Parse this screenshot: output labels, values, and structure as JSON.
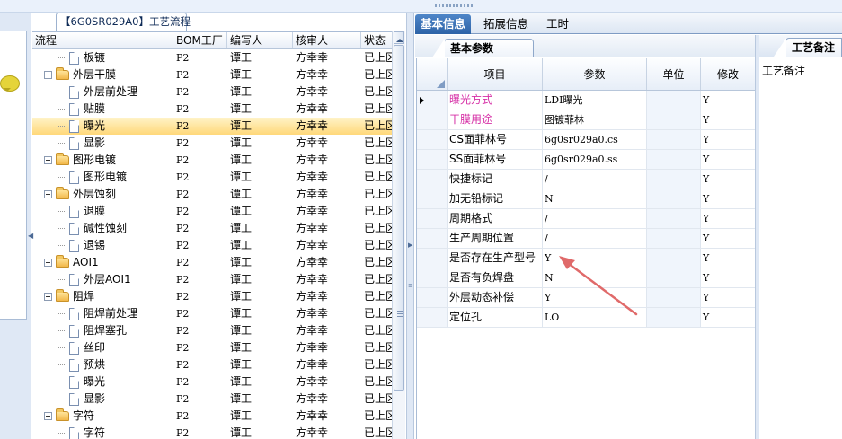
{
  "process_tab": {
    "title": "【6G0SR029A0】工艺流程"
  },
  "tree": {
    "headers": [
      "流程",
      "BOM工厂",
      "编写人",
      "核审人",
      "状态"
    ],
    "rows": [
      {
        "name": "板镀",
        "type": "doc",
        "level": 2,
        "bom": "P2",
        "writer": "谭工",
        "reviewer": "方幸幸",
        "status": "已上区"
      },
      {
        "name": "外层干膜",
        "type": "folder",
        "level": 1,
        "bom": "P2",
        "writer": "谭工",
        "reviewer": "方幸幸",
        "status": "已上区"
      },
      {
        "name": "外层前处理",
        "type": "doc",
        "level": 2,
        "bom": "P2",
        "writer": "谭工",
        "reviewer": "方幸幸",
        "status": "已上区"
      },
      {
        "name": "贴膜",
        "type": "doc",
        "level": 2,
        "bom": "P2",
        "writer": "谭工",
        "reviewer": "方幸幸",
        "status": "已上区"
      },
      {
        "name": "曝光",
        "type": "doc",
        "level": 2,
        "bom": "P2",
        "writer": "谭工",
        "reviewer": "方幸幸",
        "status": "已上区",
        "selected": true
      },
      {
        "name": "显影",
        "type": "doc",
        "level": 2,
        "bom": "P2",
        "writer": "谭工",
        "reviewer": "方幸幸",
        "status": "已上区"
      },
      {
        "name": "图形电镀",
        "type": "folder",
        "level": 1,
        "bom": "P2",
        "writer": "谭工",
        "reviewer": "方幸幸",
        "status": "已上区"
      },
      {
        "name": "图形电镀",
        "type": "doc",
        "level": 2,
        "bom": "P2",
        "writer": "谭工",
        "reviewer": "方幸幸",
        "status": "已上区"
      },
      {
        "name": "外层蚀刻",
        "type": "folder",
        "level": 1,
        "bom": "P2",
        "writer": "谭工",
        "reviewer": "方幸幸",
        "status": "已上区"
      },
      {
        "name": "退膜",
        "type": "doc",
        "level": 2,
        "bom": "P2",
        "writer": "谭工",
        "reviewer": "方幸幸",
        "status": "已上区"
      },
      {
        "name": "碱性蚀刻",
        "type": "doc",
        "level": 2,
        "bom": "P2",
        "writer": "谭工",
        "reviewer": "方幸幸",
        "status": "已上区"
      },
      {
        "name": "退锡",
        "type": "doc",
        "level": 2,
        "bom": "P2",
        "writer": "谭工",
        "reviewer": "方幸幸",
        "status": "已上区"
      },
      {
        "name": "AOI1",
        "type": "folder",
        "level": 1,
        "bom": "P2",
        "writer": "谭工",
        "reviewer": "方幸幸",
        "status": "已上区"
      },
      {
        "name": "外层AOI1",
        "type": "doc",
        "level": 2,
        "bom": "P2",
        "writer": "谭工",
        "reviewer": "方幸幸",
        "status": "已上区"
      },
      {
        "name": "阻焊",
        "type": "folder",
        "level": 1,
        "bom": "P2",
        "writer": "谭工",
        "reviewer": "方幸幸",
        "status": "已上区"
      },
      {
        "name": "阻焊前处理",
        "type": "doc",
        "level": 2,
        "bom": "P2",
        "writer": "谭工",
        "reviewer": "方幸幸",
        "status": "已上区"
      },
      {
        "name": "阻焊塞孔",
        "type": "doc",
        "level": 2,
        "bom": "P2",
        "writer": "谭工",
        "reviewer": "方幸幸",
        "status": "已上区"
      },
      {
        "name": "丝印",
        "type": "doc",
        "level": 2,
        "bom": "P2",
        "writer": "谭工",
        "reviewer": "方幸幸",
        "status": "已上区"
      },
      {
        "name": "预烘",
        "type": "doc",
        "level": 2,
        "bom": "P2",
        "writer": "谭工",
        "reviewer": "方幸幸",
        "status": "已上区"
      },
      {
        "name": "曝光",
        "type": "doc",
        "level": 2,
        "bom": "P2",
        "writer": "谭工",
        "reviewer": "方幸幸",
        "status": "已上区"
      },
      {
        "name": "显影",
        "type": "doc",
        "level": 2,
        "bom": "P2",
        "writer": "谭工",
        "reviewer": "方幸幸",
        "status": "已上区"
      },
      {
        "name": "字符",
        "type": "folder",
        "level": 1,
        "bom": "P2",
        "writer": "谭工",
        "reviewer": "方幸幸",
        "status": "已上区"
      },
      {
        "name": "字符",
        "type": "doc",
        "level": 2,
        "bom": "P2",
        "writer": "谭工",
        "reviewer": "方幸幸",
        "status": "已上区"
      }
    ]
  },
  "tabs": {
    "main": [
      "基本信息",
      "拓展信息",
      "工时"
    ],
    "sub": "基本参数"
  },
  "params": {
    "headers": [
      "项目",
      "参数",
      "单位",
      "修改"
    ],
    "rows": [
      {
        "item": "曝光方式",
        "value": "LDI曝光",
        "unit": "",
        "edit": "Y",
        "highlight": true,
        "current": true
      },
      {
        "item": "干膜用途",
        "value": "图镀菲林",
        "unit": "",
        "edit": "Y",
        "highlight": true
      },
      {
        "item": "CS面菲林号",
        "value": "6g0sr029a0.cs",
        "unit": "",
        "edit": "Y"
      },
      {
        "item": "SS面菲林号",
        "value": "6g0sr029a0.ss",
        "unit": "",
        "edit": "Y"
      },
      {
        "item": "快捷标记",
        "value": "/",
        "unit": "",
        "edit": "Y"
      },
      {
        "item": "加无铅标记",
        "value": "N",
        "unit": "",
        "edit": "Y"
      },
      {
        "item": "周期格式",
        "value": "/",
        "unit": "",
        "edit": "Y"
      },
      {
        "item": "生产周期位置",
        "value": "/",
        "unit": "",
        "edit": "Y"
      },
      {
        "item": "是否存在生产型号",
        "value": "Y",
        "unit": "",
        "edit": "Y"
      },
      {
        "item": "是否有负焊盘",
        "value": "N",
        "unit": "",
        "edit": "Y"
      },
      {
        "item": "外层动态补偿",
        "value": "Y",
        "unit": "",
        "edit": "Y"
      },
      {
        "item": "定位孔",
        "value": "LO",
        "unit": "",
        "edit": "Y"
      }
    ]
  },
  "notes_panel": {
    "tab": "工艺备注",
    "label": "工艺备注"
  },
  "colors": {
    "accent_tab": "#3a73b9",
    "highlight_text": "#d62fa6",
    "selected_row": "#ffd87a",
    "annotation_arrow": "#e06a6a"
  }
}
